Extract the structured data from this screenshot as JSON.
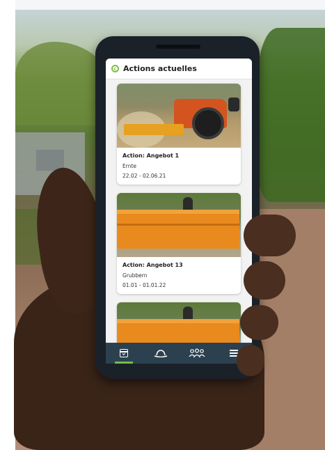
{
  "header": {
    "title": "Actions actuelles",
    "back_icon": "back-circle-icon",
    "accent_color": "#7fbf4a"
  },
  "actions": [
    {
      "title": "Action: Angebot 1",
      "type": "Ernte",
      "dates": "22.02 - 02.06.21",
      "image": "tractor-harrow-photo"
    },
    {
      "title": "Action: Angebot 13",
      "type": "Grubbern",
      "dates": "01.01 - 01.01.22",
      "image": "orange-trailer-photo"
    },
    {
      "image": "field-photo"
    }
  ],
  "tabbar": {
    "background": "#2c4150",
    "active_color": "#6fbf44",
    "items": [
      {
        "icon": "calendar-check-icon",
        "active": true
      },
      {
        "icon": "farmer-hat-icon",
        "active": false
      },
      {
        "icon": "people-group-icon",
        "active": false
      },
      {
        "icon": "hamburger-menu-icon",
        "active": false
      }
    ]
  }
}
